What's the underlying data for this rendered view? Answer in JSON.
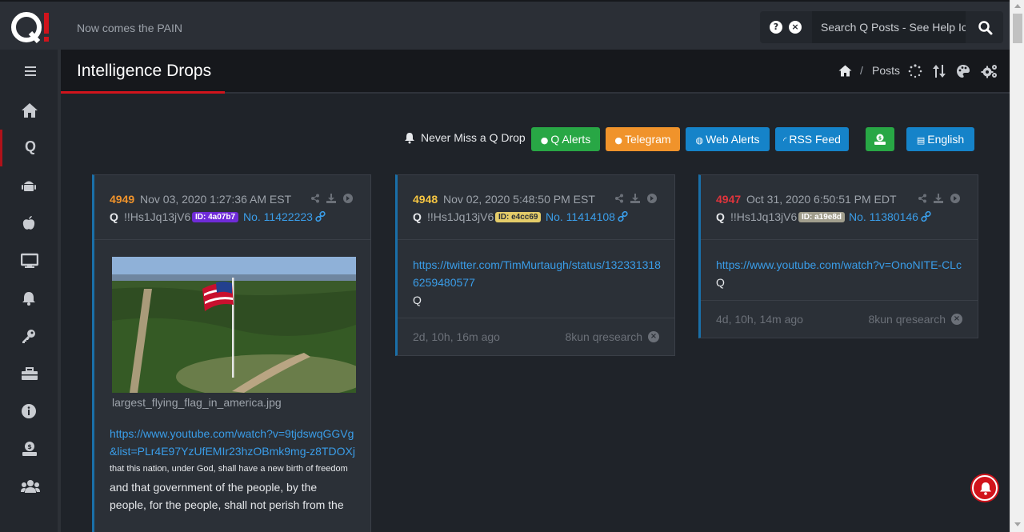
{
  "topbar": {
    "logo_text": "Q!",
    "tagline": "Now comes the PAIN",
    "search_placeholder": "Search Q Posts - See Help Icon",
    "help_icon": "question-circle-icon",
    "clear_icon": "times-circle-icon",
    "search_icon": "magnifier-icon"
  },
  "sidebar": {
    "items": [
      {
        "name": "home",
        "icon": "home-icon"
      },
      {
        "name": "q",
        "icon": "q-text-icon",
        "label": "Q",
        "active": true
      },
      {
        "name": "android",
        "icon": "android-icon"
      },
      {
        "name": "apple",
        "icon": "apple-icon"
      },
      {
        "name": "desktop",
        "icon": "desktop-icon"
      },
      {
        "name": "alerts",
        "icon": "bell-icon"
      },
      {
        "name": "key",
        "icon": "key-icon"
      },
      {
        "name": "toolbox",
        "icon": "toolbox-icon"
      },
      {
        "name": "info",
        "icon": "info-icon"
      },
      {
        "name": "donate",
        "icon": "donate-icon"
      },
      {
        "name": "users",
        "icon": "users-icon"
      }
    ]
  },
  "header": {
    "title": "Intelligence Drops",
    "breadcrumb_sep": "/",
    "breadcrumb_current": "Posts",
    "icons": [
      "spinner-icon",
      "sort-icon",
      "palette-icon",
      "cogs-icon"
    ]
  },
  "alerts": {
    "never_miss": "Never Miss a Q Drop",
    "buttons": [
      {
        "label": "Q Alerts",
        "icon": "android-icon",
        "color": "#28a745"
      },
      {
        "label": "Telegram",
        "icon": "apple-icon",
        "color": "#f0932b"
      },
      {
        "label": "Web Alerts",
        "icon": "globe-icon",
        "color": "#1583c9"
      },
      {
        "label": "RSS Feed",
        "icon": "rss-icon",
        "color": "#1583c9"
      },
      {
        "label": "",
        "icon": "donate-icon",
        "color": "#28a745"
      },
      {
        "label": "English",
        "icon": "language-icon",
        "color": "#1583c9"
      }
    ]
  },
  "posts": [
    {
      "number": "4949",
      "number_color": "#f0932b",
      "date": "Nov 03, 2020 1:27:36 AM EST",
      "author": "Q",
      "trip": "!!Hs1Jq13jV6",
      "id_badge": "ID: 4a07b7",
      "id_color": "#6f2bd8",
      "post_no": "No. 11422223",
      "image_caption": "largest_flying_flag_in_america.jpg",
      "link": "https://www.youtube.com/watch?v=9tjdswqGGVg&list=PLr4E97YzUfEMIr23hzOBmk9mg-z8TDOXj",
      "small_text": "that this nation, under God, shall have a new birth of freedom",
      "text": "and that government of the people, by the people, for the people, shall not perish from the"
    },
    {
      "number": "4948",
      "number_color": "#f5c542",
      "date": "Nov 02, 2020 5:48:50 PM EST",
      "author": "Q",
      "trip": "!!Hs1Jq13jV6",
      "id_badge": "ID: e4cc69",
      "id_color": "#e4cc69",
      "post_no": "No. 11414108",
      "link": "https://twitter.com/TimMurtaugh/status/1323313186259480577",
      "signature": "Q",
      "ago": "2d, 10h, 16m ago",
      "board": "8kun qresearch"
    },
    {
      "number": "4947",
      "number_color": "#e0343c",
      "date": "Oct 31, 2020 6:50:51 PM EDT",
      "author": "Q",
      "trip": "!!Hs1Jq13jV6",
      "id_badge": "ID: a19e8d",
      "id_color": "#a19e8d",
      "post_no": "No. 11380146",
      "link": "https://www.youtube.com/watch?v=OnoNITE-CLc",
      "signature": "Q",
      "ago": "4d, 10h, 14m ago",
      "board": "8kun qresearch"
    }
  ]
}
